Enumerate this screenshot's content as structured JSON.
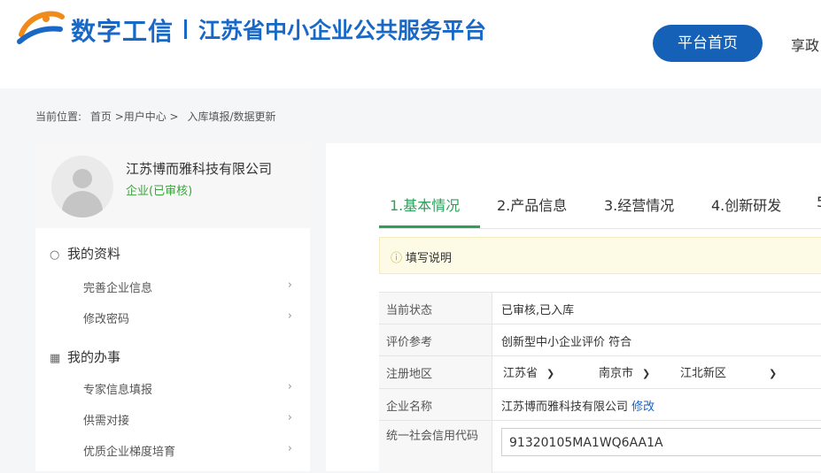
{
  "header": {
    "brand": "数字工信",
    "separator": "|",
    "platform": "江苏省中小企业公共服务平台",
    "nav_home": "平台首页",
    "nav_next": "享政"
  },
  "breadcrumb": {
    "prefix": "当前位置:",
    "path": "首页 >用户中心 >",
    "current": "入库填报/数据更新"
  },
  "profile": {
    "company": "江苏博而雅科技有限公司",
    "status": "企业(已审核)"
  },
  "sidebar": {
    "sections": [
      {
        "title": "我的资料",
        "icon": "user-icon",
        "items": [
          "完善企业信息",
          "修改密码"
        ]
      },
      {
        "title": "我的办事",
        "icon": "calendar-icon",
        "items": [
          "专家信息填报",
          "供需对接",
          "优质企业梯度培育"
        ]
      }
    ]
  },
  "tabs": [
    "1.基本情况",
    "2.产品信息",
    "3.经营情况",
    "4.创新研发",
    "5"
  ],
  "notice": {
    "text": "填写说明"
  },
  "form": {
    "status_label": "当前状态",
    "status_value": "已审核,已入库",
    "eval_label": "评价参考",
    "eval_value": "创新型中小企业评价 符合",
    "region_label": "注册地区",
    "province": "江苏省",
    "city": "南京市",
    "district": "江北新区",
    "name_label": "企业名称",
    "name_value": "江苏博而雅科技有限公司",
    "name_edit": "修改",
    "credit_label": "统一社会信用代码",
    "credit_value": "91320105MA1WQ6AA1A"
  },
  "colors": {
    "brand_blue": "#1a68c6",
    "active_green": "#2e9e5b",
    "link_blue": "#1a5fc8"
  }
}
